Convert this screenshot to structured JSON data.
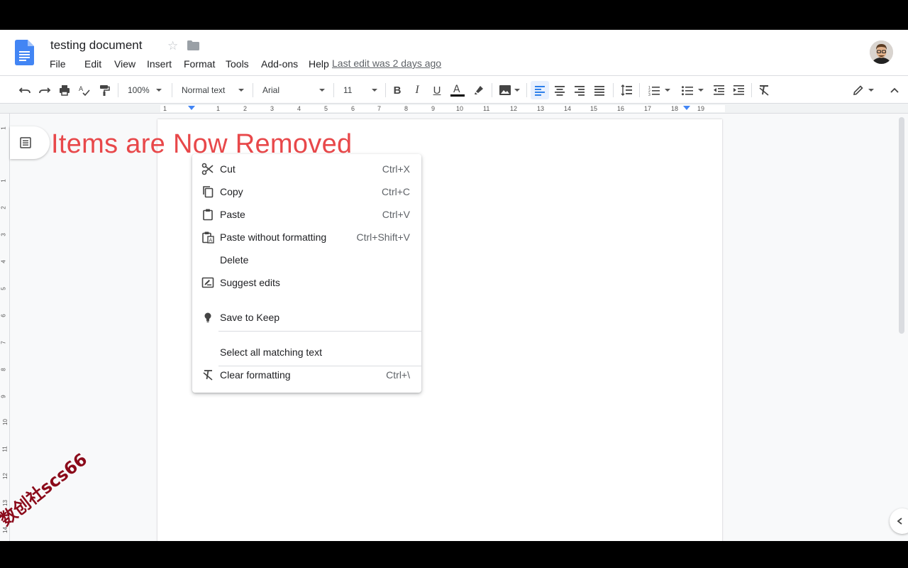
{
  "document": {
    "title": "testing document",
    "last_edit": "Last edit was 2 days ago"
  },
  "menubar": [
    "File",
    "Edit",
    "View",
    "Insert",
    "Format",
    "Tools",
    "Add-ons",
    "Help"
  ],
  "toolbar": {
    "zoom": "100%",
    "style": "Normal text",
    "font": "Arial",
    "font_size": "11"
  },
  "ruler": {
    "numbers": [
      "1",
      "1",
      "2",
      "3",
      "4",
      "5",
      "6",
      "7",
      "8",
      "9",
      "10",
      "11",
      "12",
      "13",
      "14",
      "15",
      "16",
      "17",
      "18",
      "19"
    ],
    "vertical_numbers": [
      "1",
      "1",
      "2",
      "3",
      "4",
      "5",
      "6",
      "7",
      "8",
      "9",
      "10",
      "11",
      "12",
      "13",
      "14"
    ]
  },
  "overlay": {
    "text": "Items are Now Removed",
    "color": "#e8484a"
  },
  "context_menu": {
    "items": [
      {
        "label": "Cut",
        "shortcut": "Ctrl+X",
        "icon": "scissors-icon"
      },
      {
        "label": "Copy",
        "shortcut": "Ctrl+C",
        "icon": "copy-icon"
      },
      {
        "label": "Paste",
        "shortcut": "Ctrl+V",
        "icon": "clipboard-icon"
      },
      {
        "label": "Paste without formatting",
        "shortcut": "Ctrl+Shift+V",
        "icon": "paste-plain-icon"
      },
      {
        "label": "Delete",
        "shortcut": "",
        "icon": ""
      },
      {
        "label": "Suggest edits",
        "shortcut": "",
        "icon": "suggest-edits-icon"
      },
      {
        "label": "Save to Keep",
        "shortcut": "",
        "icon": "lightbulb-icon"
      },
      {
        "label": "Select all matching text",
        "shortcut": "",
        "icon": ""
      },
      {
        "label": "Clear formatting",
        "shortcut": "Ctrl+\\",
        "icon": "clear-format-icon"
      }
    ]
  },
  "watermark": "数创社scs66",
  "colors": {
    "accent": "#1a73e8",
    "docs_blue": "#4285f4",
    "active_bg": "#e8f0fe"
  }
}
